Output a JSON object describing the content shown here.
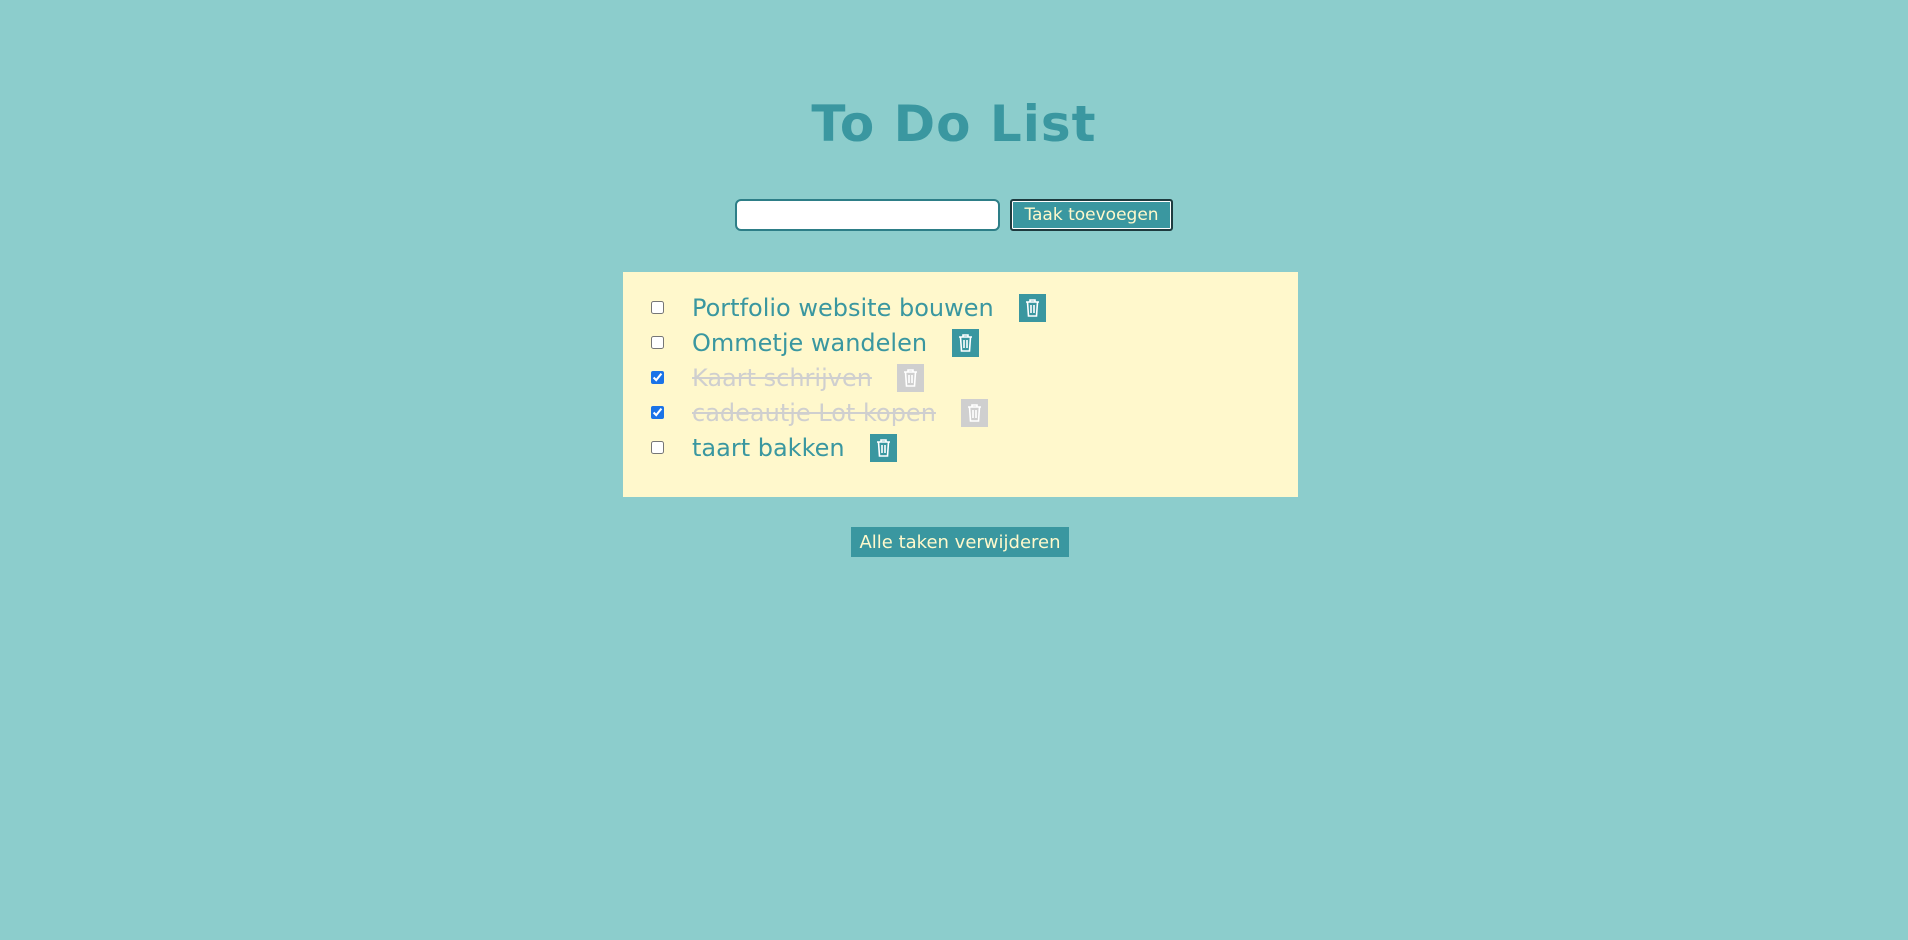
{
  "header": {
    "title": "To Do List"
  },
  "add_form": {
    "input_value": "",
    "input_placeholder": "",
    "button_label": "Taak toevoegen"
  },
  "tasks": [
    {
      "label": "Portfolio website bouwen",
      "done": false
    },
    {
      "label": "Ommetje wandelen",
      "done": false
    },
    {
      "label": "Kaart schrijven",
      "done": true
    },
    {
      "label": "cadeautje Lot kopen",
      "done": true
    },
    {
      "label": "taart bakken",
      "done": false
    }
  ],
  "footer": {
    "clear_all_label": "Alle taken verwijderen"
  },
  "colors": {
    "background": "#8ccdcc",
    "accent": "#3a97a0",
    "panel": "#fff8cc",
    "done_text": "#cfcfcf"
  },
  "icons": {
    "delete": "trash-icon"
  }
}
